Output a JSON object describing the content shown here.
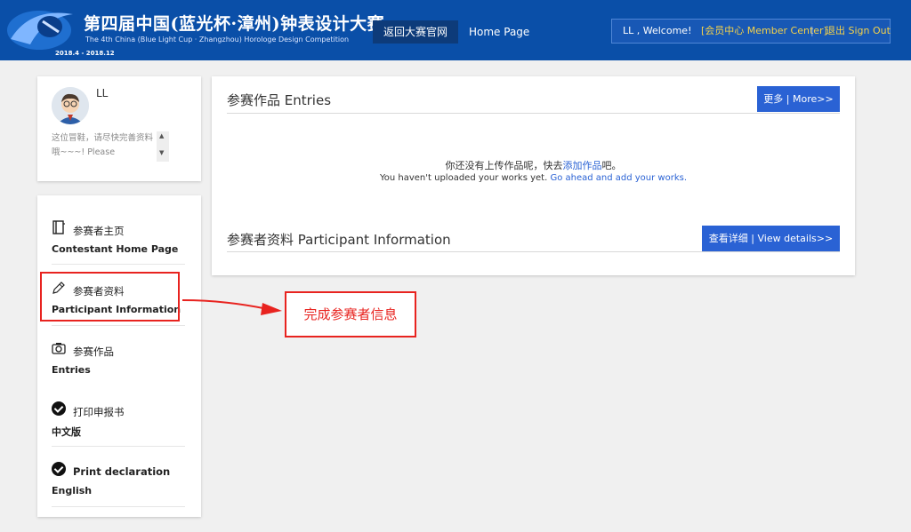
{
  "header": {
    "title_zh": "第四届中国(蓝光杯·漳州)钟表设计大赛",
    "title_en": "The 4th China (Blue Light Cup · Zhangzhou) Horologe Design Competition",
    "date_range": "2018.4 - 2018.12",
    "nav_back": "返回大赛官网",
    "nav_home": "Home Page",
    "welcome": "LL , Welcome!",
    "member_center": "[会员中心 Member Center]",
    "separator": "|",
    "sign_out": "退出 Sign Out",
    "brand_color": "#0a4fa8"
  },
  "profile": {
    "username": "LL",
    "bio": "这位冒鞋，请尽快完善资料哦~~~! Please"
  },
  "menu": {
    "items": [
      {
        "icon": "notebook-icon",
        "zh": "参赛者主页",
        "en": "Contestant Home Page"
      },
      {
        "icon": "pencil-icon",
        "zh": "参赛者资料",
        "en": "Participant Information"
      },
      {
        "icon": "camera-icon",
        "zh": "参赛作品",
        "en": "Entries"
      },
      {
        "icon": "check-circle-icon",
        "zh": "打印申报书",
        "en": "中文版"
      },
      {
        "icon": "check-circle-icon",
        "zh": "Print declaration",
        "en": "English"
      }
    ]
  },
  "annotation": {
    "text": "完成参赛者信息",
    "color": "#e8231f"
  },
  "entries": {
    "title": "参赛作品 Entries",
    "more_button": "更多 | More>>",
    "empty_zh_prefix": "你还没有上传作品呢，快去",
    "empty_zh_link": "添加作品",
    "empty_zh_suffix": "吧。",
    "empty_en_prefix": "You haven't uploaded your works yet.",
    "empty_en_link": "Go ahead and add your works."
  },
  "participant": {
    "title": "参赛者资料 Participant Information",
    "details_button": "查看详细 | View details>>"
  },
  "accent_color": "#2a62d4"
}
